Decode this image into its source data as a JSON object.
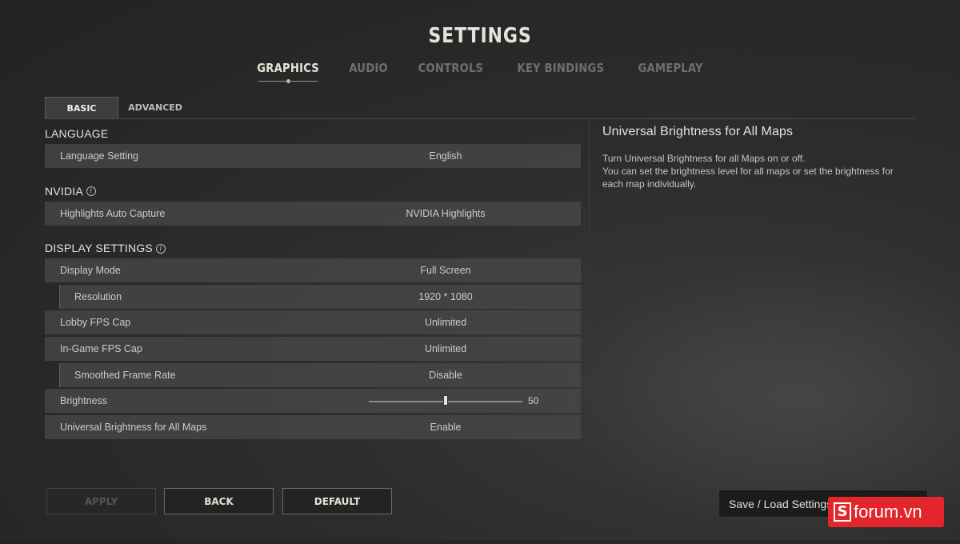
{
  "title": "SETTINGS",
  "top_tabs": [
    "GRAPHICS",
    "AUDIO",
    "CONTROLS",
    "KEY BINDINGS",
    "GAMEPLAY"
  ],
  "sub_tabs": [
    "BASIC",
    "ADVANCED"
  ],
  "sections": {
    "language": {
      "title": "LANGUAGE",
      "rows": {
        "language": {
          "label": "Language Setting",
          "value": "English"
        }
      }
    },
    "nvidia": {
      "title": "NVIDIA",
      "rows": {
        "highlights": {
          "label": "Highlights Auto Capture",
          "value": "NVIDIA Highlights"
        }
      }
    },
    "display": {
      "title": "DISPLAY SETTINGS",
      "rows": {
        "display_mode": {
          "label": "Display Mode",
          "value": "Full Screen"
        },
        "resolution": {
          "label": "Resolution",
          "value": "1920 * 1080"
        },
        "lobby_fps": {
          "label": "Lobby FPS Cap",
          "value": "Unlimited"
        },
        "ingame_fps": {
          "label": "In-Game FPS Cap",
          "value": "Unlimited"
        },
        "smoothed": {
          "label": "Smoothed Frame Rate",
          "value": "Disable"
        },
        "brightness": {
          "label": "Brightness",
          "value": "50",
          "min": 0,
          "max": 100
        },
        "universal": {
          "label": "Universal Brightness for All Maps",
          "value": "Enable"
        }
      }
    }
  },
  "info_icon": "i",
  "description": {
    "title": "Universal Brightness for All Maps",
    "lines": [
      "Turn Universal Brightness for all Maps on or off.",
      "You can set the brightness level for all maps or set the brightness for",
      "each map individually."
    ]
  },
  "buttons": {
    "apply": "APPLY",
    "back": "BACK",
    "default": "DEFAULT"
  },
  "save_load": "Save / Load Settings",
  "watermark": {
    "mark": "S",
    "text": "forum.vn"
  },
  "colors": {
    "accent": "#e3262b",
    "active_tab": "#e6e2d8",
    "inactive_tab": "#6e6e6e"
  }
}
